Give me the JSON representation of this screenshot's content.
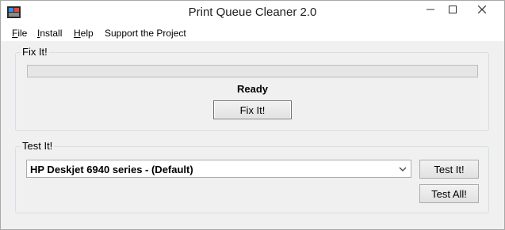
{
  "window": {
    "title": "Print Queue Cleaner 2.0",
    "icon": "app-icon"
  },
  "menu": {
    "items": [
      {
        "label": "File",
        "accel": "F",
        "rest": "ile"
      },
      {
        "label": "Install",
        "accel": "I",
        "rest": "nstall"
      },
      {
        "label": "Help",
        "accel": "H",
        "rest": "elp"
      },
      {
        "label": "Support the Project",
        "accel": "",
        "rest": "Support the Project"
      }
    ]
  },
  "fix_group": {
    "title": "Fix It!",
    "progress_fraction": 0,
    "status": "Ready",
    "fix_button": "Fix It!"
  },
  "test_group": {
    "title": "Test It!",
    "printer_selected": "HP Deskjet 6940 series - (Default)",
    "test_button": "Test It!",
    "test_all_button": "Test All!"
  },
  "colors": {
    "titlebar_bg": "#ffffff",
    "window_bg": "#f0f0f0",
    "groupbox_border": "#d5dfe5",
    "close_hover": "#e81123"
  }
}
